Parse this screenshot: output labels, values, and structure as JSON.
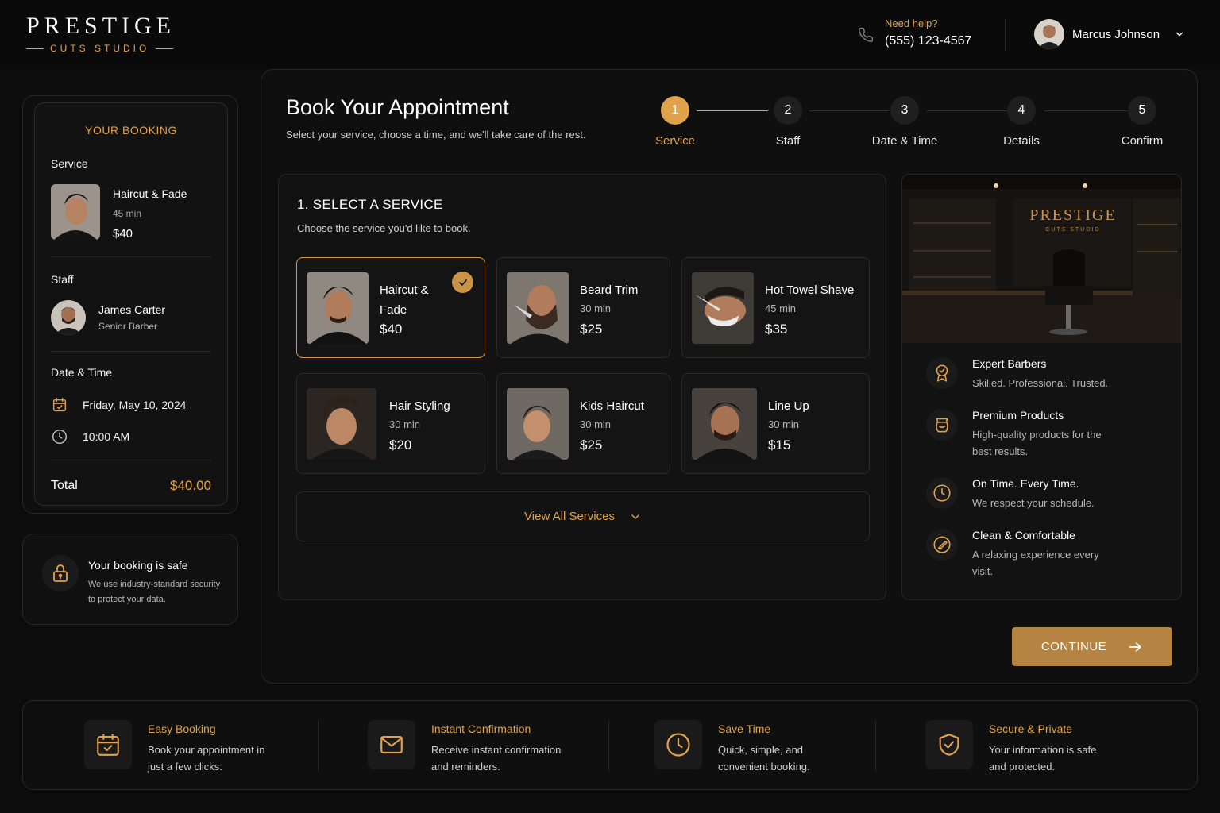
{
  "brand": {
    "name": "PRESTIGE",
    "tagline": "CUTS STUDIO",
    "accent": "#e0a24a"
  },
  "header": {
    "help_label": "Need help?",
    "phone": "(555) 123-4567",
    "user_name": "Marcus Johnson"
  },
  "booking": {
    "title": "YOUR BOOKING",
    "service_label": "Service",
    "service": {
      "name": "Haircut & Fade",
      "duration": "45 min",
      "price": "$40"
    },
    "staff_label": "Staff",
    "staff": {
      "name": "James Carter",
      "role": "Senior Barber"
    },
    "datetime_label": "Date & Time",
    "date": "Friday, May 10, 2024",
    "time": "10:00 AM",
    "total_label": "Total",
    "total_value": "$40.00"
  },
  "safe": {
    "title": "Your booking is safe",
    "text": "We use industry-standard security to protect your data."
  },
  "main": {
    "title": "Book Your Appointment",
    "subtitle": "Select your service, choose a time, and we'll take care of the rest."
  },
  "steps": [
    {
      "num": "1",
      "label": "Service"
    },
    {
      "num": "2",
      "label": "Staff"
    },
    {
      "num": "3",
      "label": "Date & Time"
    },
    {
      "num": "4",
      "label": "Details"
    },
    {
      "num": "5",
      "label": "Confirm"
    }
  ],
  "service_panel": {
    "title": "1. SELECT A SERVICE",
    "subtitle": "Choose the service you'd like to book.",
    "view_all": "View All Services"
  },
  "services": [
    {
      "name": "Haircut & Fade",
      "name_line1": "Haircut &",
      "name_line2": "Fade",
      "duration": "",
      "price": "$40"
    },
    {
      "name": "Beard Trim",
      "duration": "30 min",
      "price": "$25"
    },
    {
      "name": "Hot Towel Shave",
      "duration": "45 min",
      "price": "$35"
    },
    {
      "name": "Hair Styling",
      "duration": "30 min",
      "price": "$20"
    },
    {
      "name": "Kids Haircut",
      "duration": "30 min",
      "price": "$25"
    },
    {
      "name": "Line Up",
      "duration": "30 min",
      "price": "$15"
    }
  ],
  "shop_image": {
    "sign_name": "PRESTIGE",
    "sign_sub": "CUTS STUDIO"
  },
  "features": [
    {
      "icon": "award-icon",
      "title": "Expert Barbers",
      "text": "Skilled. Professional. Trusted."
    },
    {
      "icon": "product-icon",
      "title": "Premium Products",
      "text": "High-quality products for the best results."
    },
    {
      "icon": "clock-icon",
      "title": "On Time. Every Time.",
      "text": "We respect your schedule."
    },
    {
      "icon": "razor-icon",
      "title": "Clean & Comfortable",
      "text": "A relaxing experience every visit."
    }
  ],
  "continue_label": "CONTINUE",
  "bottom_features": [
    {
      "icon": "calendar-check-icon",
      "title": "Easy Booking",
      "text": "Book your appointment in just a few clicks."
    },
    {
      "icon": "envelope-icon",
      "title": "Instant Confirmation",
      "text": "Receive instant confirmation and reminders."
    },
    {
      "icon": "clock-icon",
      "title": "Save Time",
      "text": "Quick, simple, and convenient booking."
    },
    {
      "icon": "shield-check-icon",
      "title": "Secure & Private",
      "text": "Your information is safe and protected."
    }
  ]
}
